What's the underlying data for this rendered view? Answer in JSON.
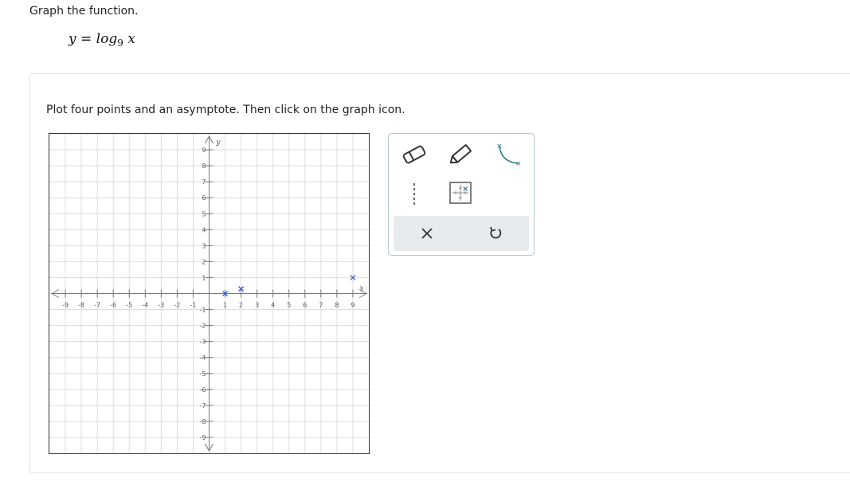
{
  "question": {
    "prompt": "Graph the function.",
    "equation_lhs": "y = log",
    "equation_base": "9",
    "equation_arg": "x"
  },
  "instructions": "Plot four points and an asymptote. Then click on the graph icon.",
  "graph": {
    "x_axis_label": "x",
    "y_axis_label": "y",
    "x_range": [
      -10,
      10
    ],
    "y_range": [
      -10,
      10
    ],
    "grid": true,
    "x_tick_labels": [
      "-9",
      "-8",
      "-7",
      "-6",
      "-5",
      "-4",
      "-3",
      "-2",
      "-1",
      "1",
      "2",
      "3",
      "4",
      "5",
      "6",
      "7",
      "8",
      "9"
    ],
    "y_tick_labels": [
      "9",
      "8",
      "7",
      "6",
      "5",
      "4",
      "3",
      "2",
      "1",
      "-1",
      "-2",
      "-3",
      "-4",
      "-5",
      "-6",
      "-7",
      "-8",
      "-9"
    ],
    "plotted_points": [
      {
        "x": 1,
        "y": 0
      },
      {
        "x": 2,
        "y": 0.3
      },
      {
        "x": 9,
        "y": 1
      }
    ],
    "point_color": "#3a5bd9"
  },
  "toolbar": {
    "tools": [
      {
        "name": "eraser-tool-icon"
      },
      {
        "name": "pencil-tool-icon"
      },
      {
        "name": "curve-tool-icon"
      },
      {
        "name": "asymptote-tool-icon"
      },
      {
        "name": "graph-check-icon"
      }
    ],
    "actions": [
      {
        "name": "clear-icon"
      },
      {
        "name": "undo-icon"
      }
    ],
    "accent_color": "#1f7a8c",
    "actionbar_color": "#e6eaed"
  }
}
